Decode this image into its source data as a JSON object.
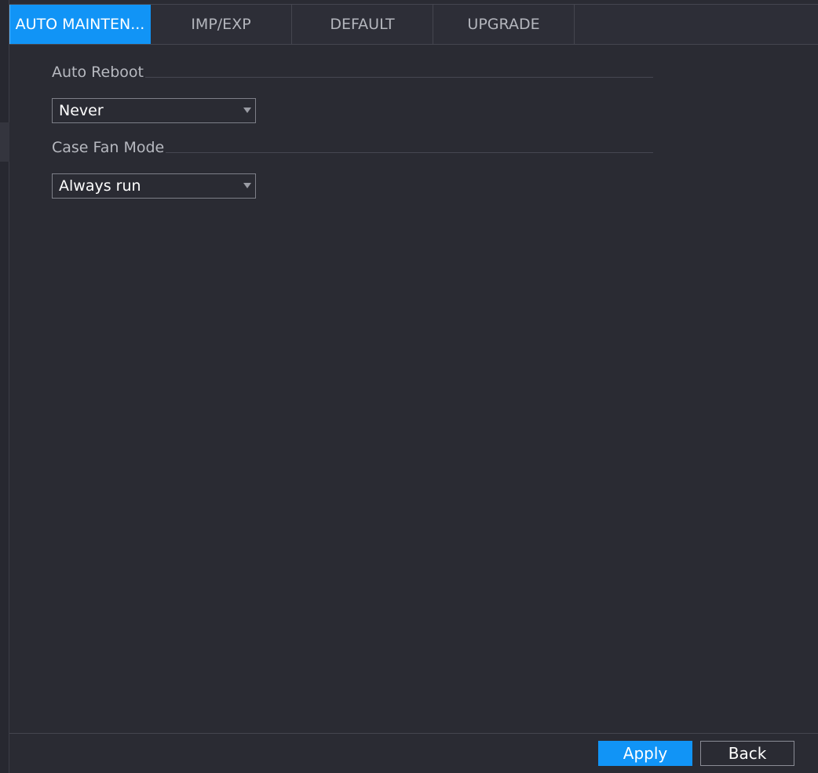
{
  "tabs": [
    {
      "label": "AUTO MAINTEN...",
      "active": true
    },
    {
      "label": "IMP/EXP",
      "active": false
    },
    {
      "label": "DEFAULT",
      "active": false
    },
    {
      "label": "UPGRADE",
      "active": false
    }
  ],
  "auto_reboot": {
    "title": "Auto Reboot",
    "selected": "Never"
  },
  "case_fan_mode": {
    "title": "Case Fan Mode",
    "selected": "Always run"
  },
  "footer": {
    "apply_label": "Apply",
    "back_label": "Back"
  },
  "colors": {
    "accent": "#1194f6",
    "background": "#2a2b33"
  }
}
